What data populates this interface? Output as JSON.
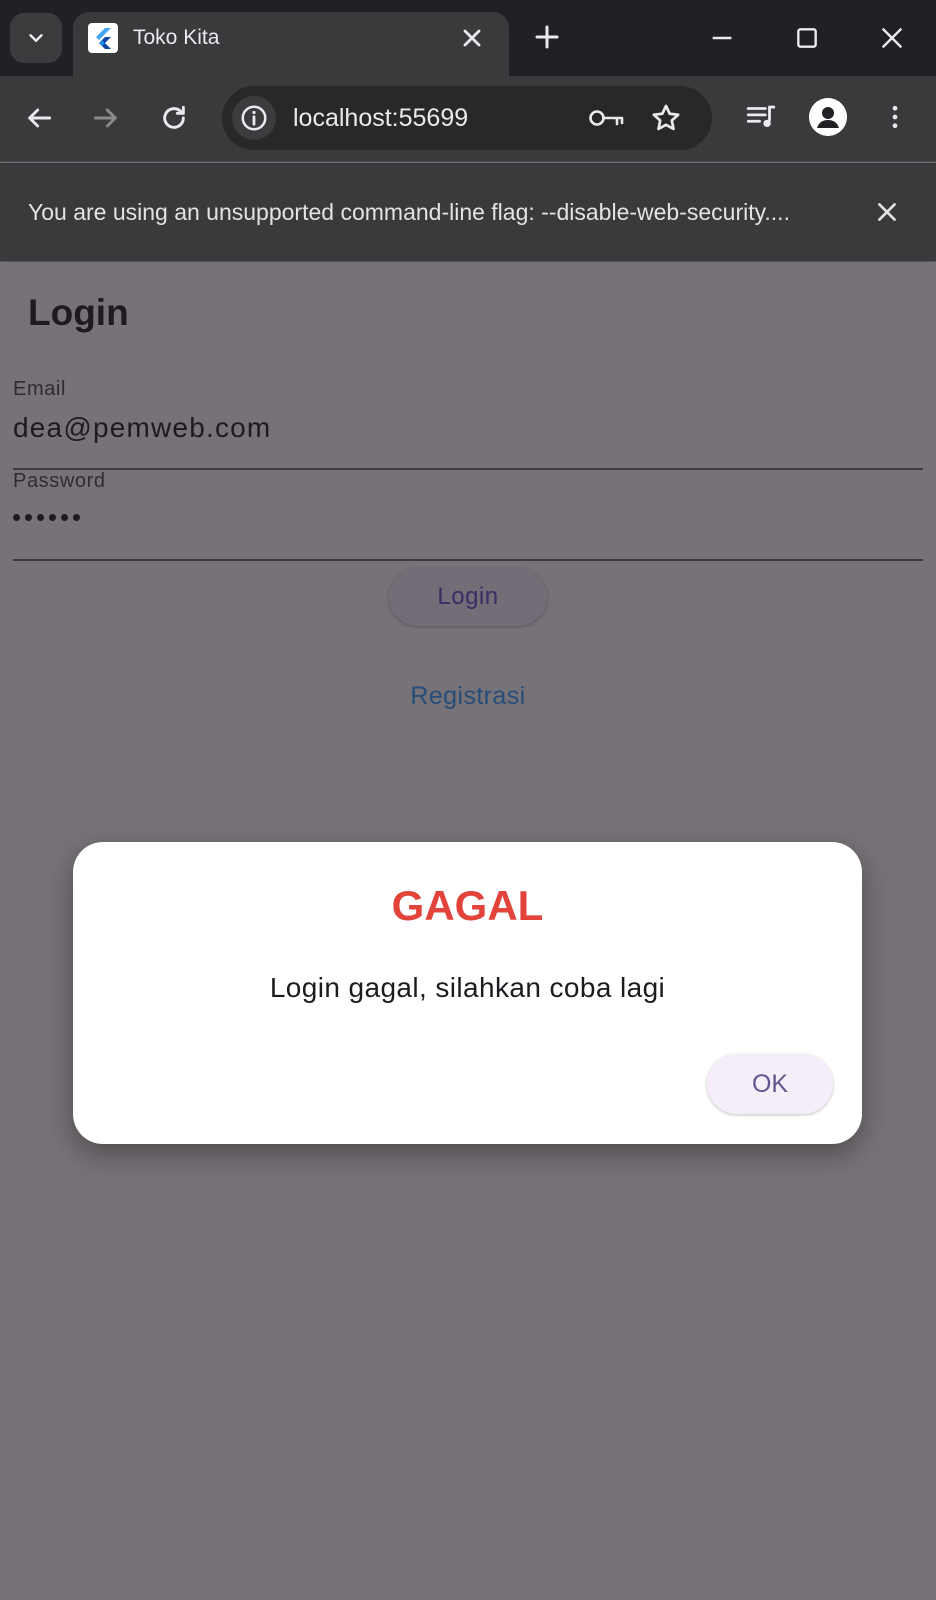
{
  "browser": {
    "tab": {
      "title": "Toko Kita",
      "favicon": "flutter-logo-icon"
    },
    "url": "localhost:55699",
    "icons": [
      "tab-search-icon",
      "close-icon",
      "plus-icon",
      "minimize-icon",
      "maximize-icon",
      "back-arrow-icon",
      "forward-arrow-icon",
      "reload-icon",
      "site-info-icon",
      "key-icon",
      "star-icon",
      "media-queue-icon",
      "profile-icon",
      "more-vert-icon"
    ],
    "infobar": {
      "text": "You are using an unsupported command-line flag: --disable-web-security...."
    }
  },
  "page": {
    "title": "Login",
    "email": {
      "label": "Email",
      "value": "dea@pemweb.com"
    },
    "password": {
      "label": "Password",
      "masked_length": 6
    },
    "login_button": "Login",
    "register_link": "Registrasi"
  },
  "dialog": {
    "title": "GAGAL",
    "message": "Login gagal, silahkan coba lagi",
    "ok_button": "OK"
  },
  "colors": {
    "scrim_background": "#777277",
    "dialog_title": "#e2433a",
    "link": "#264d78",
    "button_text": "#65558f"
  }
}
